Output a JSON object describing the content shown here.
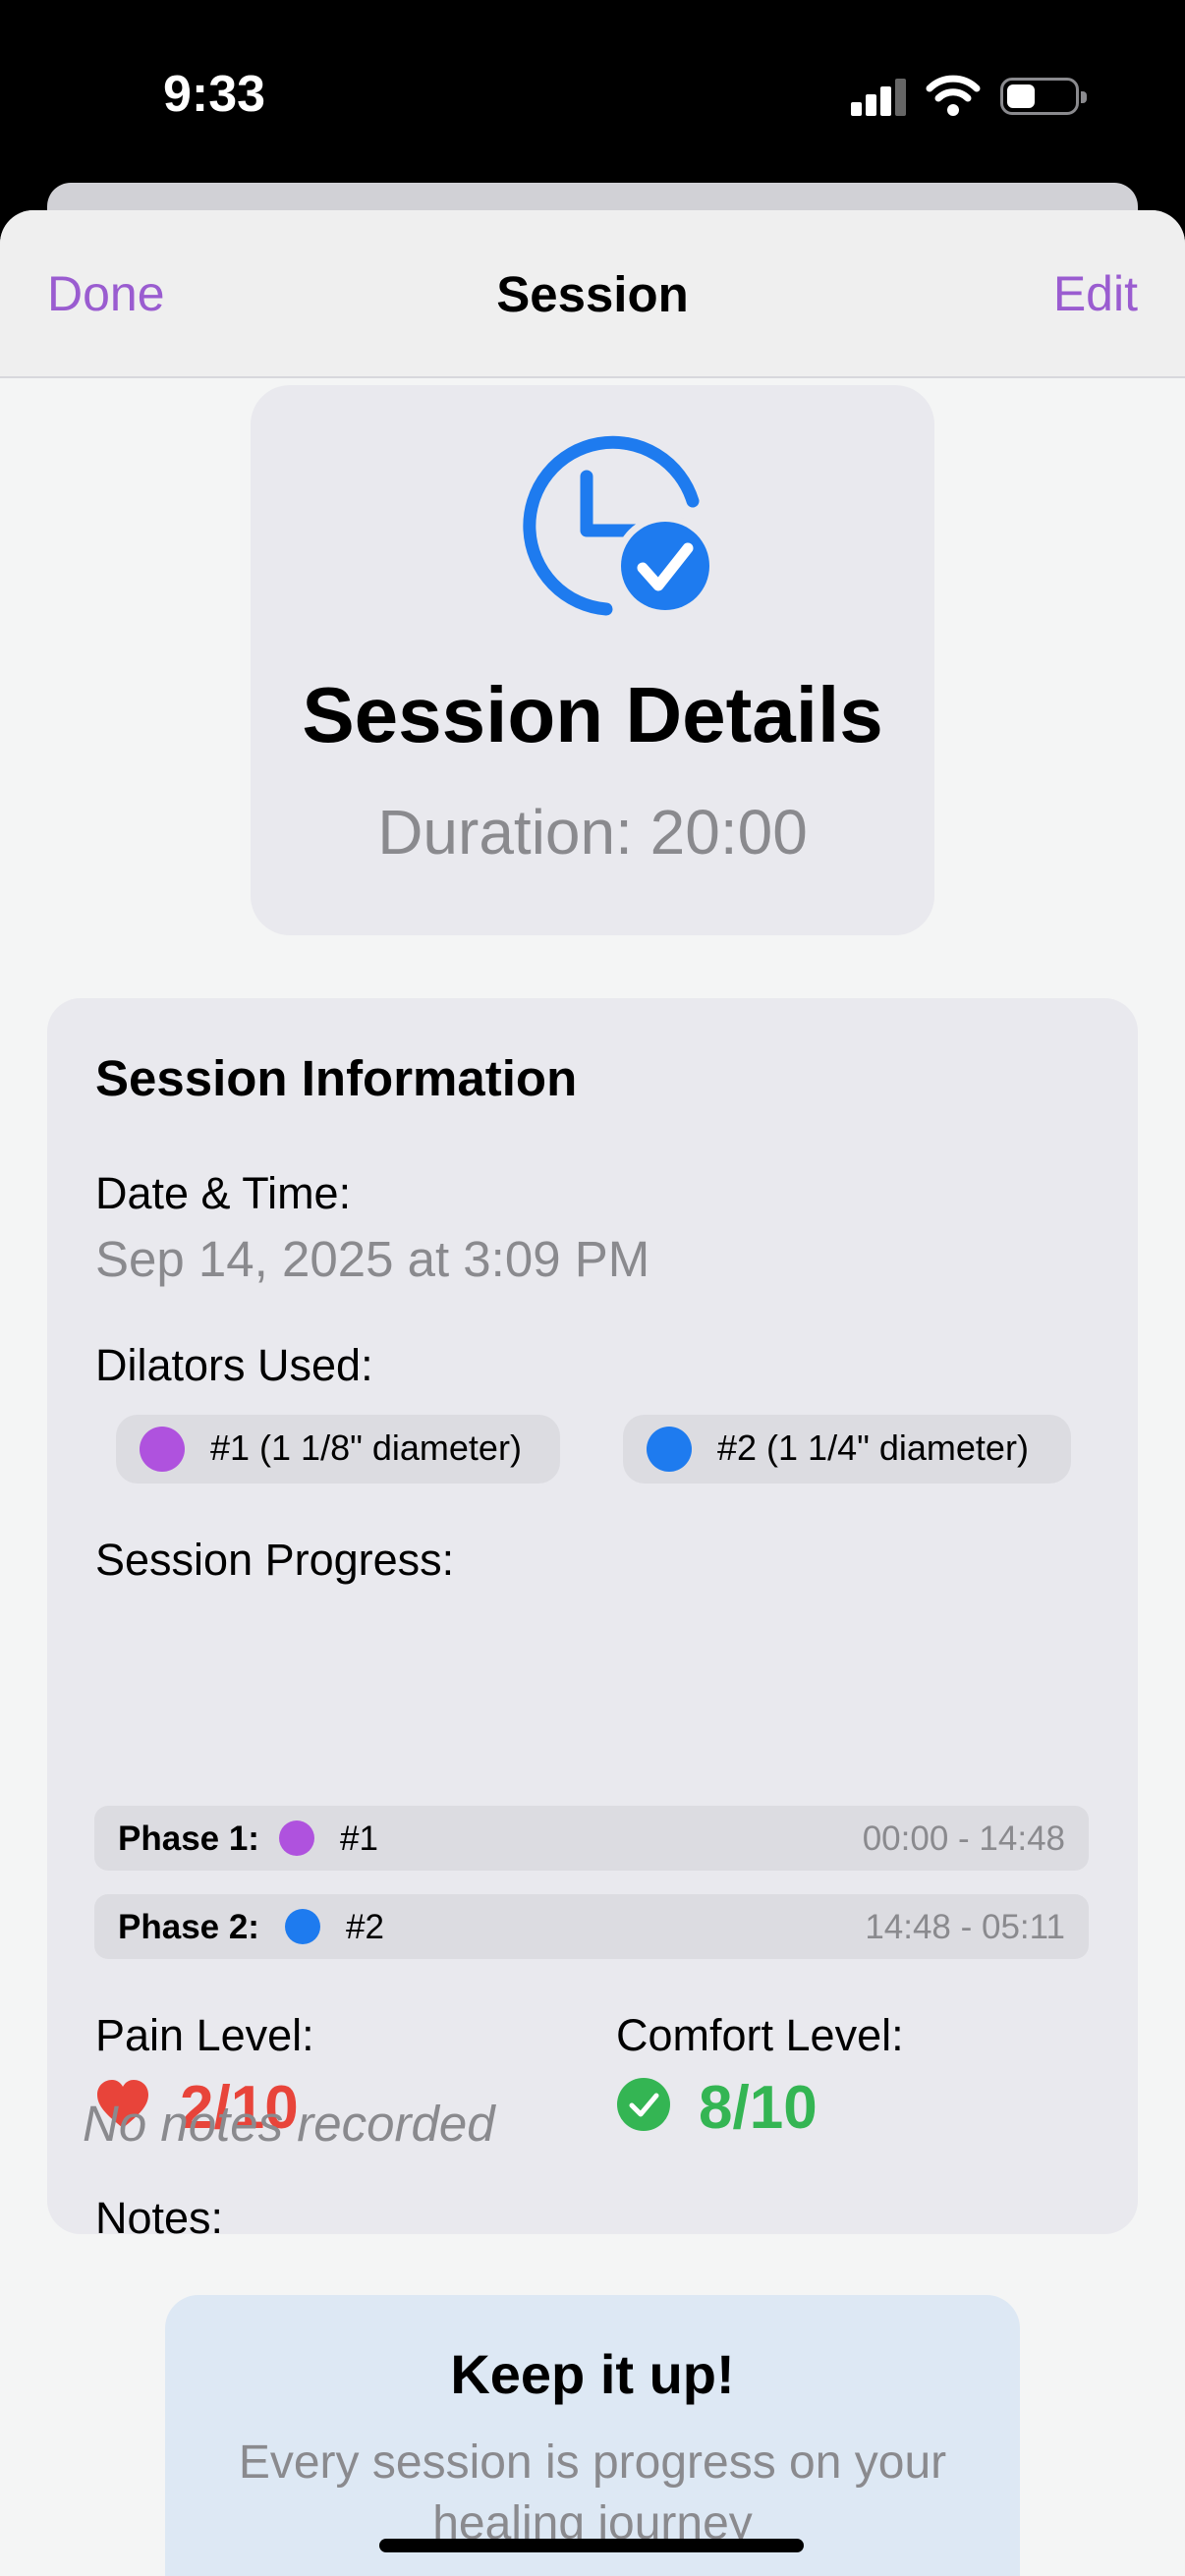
{
  "status_bar": {
    "time": "9:33",
    "battery_level": 0.3
  },
  "nav": {
    "done_label": "Done",
    "title": "Session",
    "edit_label": "Edit"
  },
  "header": {
    "icon": "clock-checkmark-icon",
    "title": "Session Details",
    "duration": "Duration: 20:00"
  },
  "info": {
    "section_title": "Session Information",
    "date_label": "Date & Time:",
    "date_value": "Sep 14, 2025 at 3:09 PM",
    "dilators_label": "Dilators Used:",
    "dilators": [
      {
        "label": "#1 (1 1/8\" diameter)",
        "color": "#af52de"
      },
      {
        "label": "#2 (1 1/4\" diameter)",
        "color": "#1e7bef"
      }
    ],
    "progress_label": "Session Progress:",
    "phases": [
      {
        "label": "Phase 1:",
        "dilator": "#1",
        "color": "#af52de",
        "time": "00:00 - 14:48"
      },
      {
        "label": "Phase 2:",
        "dilator": "#2",
        "color": "#1e7bef",
        "time": "14:48 - 05:11"
      }
    ],
    "pain_label": "Pain Level:",
    "pain_value": "2/10",
    "pain_icon": "heart-icon",
    "comfort_label": "Comfort Level:",
    "comfort_value": "8/10",
    "comfort_icon": "checkmark-circle-icon",
    "notes_label": "Notes:",
    "notes_value": "No notes recorded"
  },
  "encouragement": {
    "title": "Keep it up!",
    "text": "Every session is progress on your healing journey"
  },
  "colors": {
    "accent": "#9a5cd0",
    "blue": "#1e7bef",
    "pain": "#e8443a",
    "comfort": "#34b553"
  }
}
